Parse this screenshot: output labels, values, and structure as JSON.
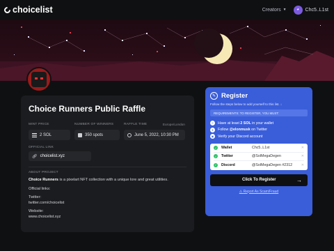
{
  "header": {
    "brand": "choicelist",
    "creators_label": "Creators",
    "user_name": "Chc5..L1st"
  },
  "project": {
    "title": "Choice Runners Public Raffle",
    "mint_price_label": "MINT PRICE",
    "mint_price": "2 SOL",
    "winners_label": "NUMBER OF WINNERS",
    "winners": "350 spots",
    "raffle_time_label": "RAFFLE TIME",
    "timezone": "Europe/London",
    "raffle_time": "June 5, 2022, 10:30 PM",
    "official_link_label": "OFFICIAL LINK",
    "official_link": "choicelist.xyz",
    "about_label": "ABOUT PROJECT",
    "about_name": "Choice Runners",
    "about_text": " is a pixelart NFT collection with a unique lore and great utilities.",
    "links_heading": "Official links:",
    "twitter_label": "Twitter:",
    "twitter_value": "twitter.com/choicelist",
    "website_label": "Website:",
    "website_value": "www.choicelist.xyz"
  },
  "register": {
    "title": "Register",
    "subtitle": "Follow the steps below to add yourself to this list. ↓",
    "requirements_label": "REQUIREMENTS: TO REGISTER, YOU MUST:",
    "requirements": [
      {
        "pre": "Have at least ",
        "bold": "2 SOL",
        "post": " in your wallet",
        "icon": "sol-icon"
      },
      {
        "pre": "Follow ",
        "bold": "@elonmusk",
        "post": " on Twitter",
        "icon": "twitter-icon"
      },
      {
        "pre": "Verify your Discord account",
        "bold": "",
        "post": "",
        "icon": "discord-icon"
      }
    ],
    "accounts": [
      {
        "name": "Wallet",
        "value": "Chc5..L1st"
      },
      {
        "name": "Twitter",
        "value": "@SolMegaDegen"
      },
      {
        "name": "Discord",
        "value": "@SolMegaDegen #2312"
      }
    ],
    "button_label": "Click To Register",
    "report_label": "Report As Scam/Fraud"
  },
  "colors": {
    "accent": "#3a5dd9",
    "background": "#0f1012",
    "card": "#1a1c1f"
  }
}
